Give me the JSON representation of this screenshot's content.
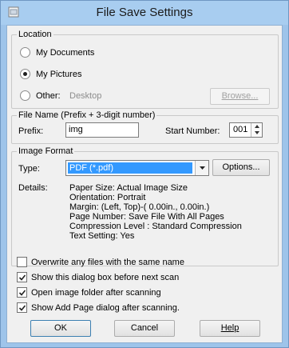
{
  "window": {
    "title": "File Save Settings"
  },
  "location": {
    "legend": "Location",
    "options": [
      {
        "label": "My Documents",
        "selected": false
      },
      {
        "label": "My Pictures",
        "selected": true
      },
      {
        "label": "Other:",
        "selected": false
      }
    ],
    "other_path": "Desktop",
    "browse_label": "Browse..."
  },
  "file_name": {
    "legend": "File Name (Prefix + 3-digit number)",
    "prefix_label": "Prefix:",
    "prefix_value": "img",
    "start_number_label": "Start Number:",
    "start_number_value": "001"
  },
  "image_format": {
    "legend": "Image Format",
    "type_label": "Type:",
    "type_value": "PDF (*.pdf)",
    "options_label": "Options...",
    "details_label": "Details:",
    "details": [
      "Paper Size: Actual Image Size",
      "Orientation: Portrait",
      "Margin: (Left, Top)-( 0.00in., 0.00in.)",
      "Page Number: Save File With All Pages",
      "Compression Level : Standard Compression",
      "Text Setting: Yes"
    ]
  },
  "checkboxes": [
    {
      "label": "Overwrite any files with the same name",
      "checked": false
    },
    {
      "label": "Show this dialog box before next scan",
      "checked": true
    },
    {
      "label": "Open image folder after scanning",
      "checked": true
    },
    {
      "label": "Show Add Page dialog after scanning.",
      "checked": true
    }
  ],
  "buttons": {
    "ok": "OK",
    "cancel": "Cancel",
    "help": "Help"
  }
}
